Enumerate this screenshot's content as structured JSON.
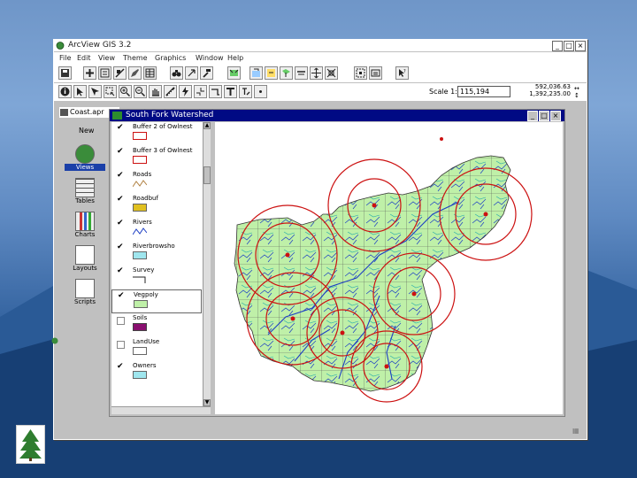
{
  "app": {
    "title": "ArcView GIS 3.2",
    "window_buttons": [
      "_",
      "□",
      "×"
    ]
  },
  "menu": [
    "File",
    "Edit",
    "View",
    "Theme",
    "Graphics",
    "Window",
    "Help"
  ],
  "toolbar": {
    "scale_label": "Scale 1:",
    "scale_value": "115,194",
    "coord_x": "592,036.63",
    "coord_y": "1,392,235.00",
    "coord_arrows_x": "↔",
    "coord_arrows_y": "↕"
  },
  "project_window": {
    "title": "Coast.apr",
    "new_label": "New",
    "items": [
      "Views",
      "Tables",
      "Charts",
      "Layouts",
      "Scripts"
    ]
  },
  "view_window": {
    "title": "South Fork Watershed",
    "buttons": [
      "_",
      "□",
      "×"
    ]
  },
  "layers": [
    {
      "name": "Buffer 2 of Owlnest",
      "checked": true
    },
    {
      "name": "Buffer 3 of Owlnest",
      "checked": true
    },
    {
      "name": "Roads",
      "checked": true
    },
    {
      "name": "Roadbuf",
      "checked": true
    },
    {
      "name": "Rivers",
      "checked": true
    },
    {
      "name": "Riverbrowsho",
      "checked": true
    },
    {
      "name": "Survey",
      "checked": true
    },
    {
      "name": "Vegpoly",
      "checked": true
    },
    {
      "name": "Soils",
      "checked": false
    },
    {
      "name": "LandUse",
      "checked": false
    },
    {
      "name": "Owners",
      "checked": true
    }
  ],
  "colors": {
    "title_active": "#000a84",
    "veg_fill": "#bff0a8",
    "buffer_red": "#cc1111",
    "river_blue": "#1d3fc4",
    "road_brown": "#b08040",
    "roadbuf_fill": "#e0c020",
    "riverbuf_fill": "#9fe6ee",
    "soils_fill": "#8a1070",
    "owners_fill": "#9fe6ee"
  }
}
